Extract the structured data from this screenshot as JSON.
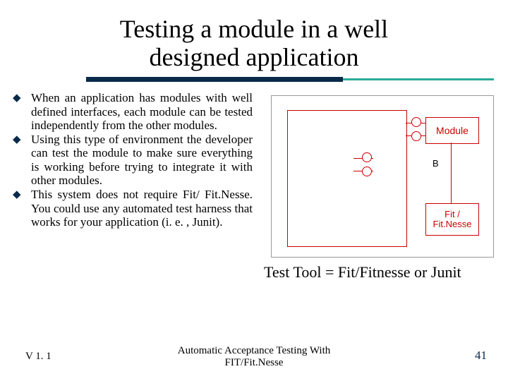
{
  "title_line1": "Testing a module in a well",
  "title_line2": "designed application",
  "bullets": [
    "When an application has modules with well defined interfaces, each module can be tested independently from the other modules.",
    "Using this type of environment the developer can test the module to make sure everything is working before trying to integrate it with other modules.",
    "This system does not require Fit/ Fit.Nesse. You could use any automated test harness that works for your application (i. e. , Junit)."
  ],
  "diagram": {
    "module_label": "Module",
    "fit_label": "Fit /\nFit.Nesse",
    "b_label": "B"
  },
  "caption": "Test Tool = Fit/Fitnesse or Junit",
  "footer": {
    "version": "V 1. 1",
    "center": "Automatic Acceptance Testing With\nFIT/Fit.Nesse",
    "page": "41"
  }
}
